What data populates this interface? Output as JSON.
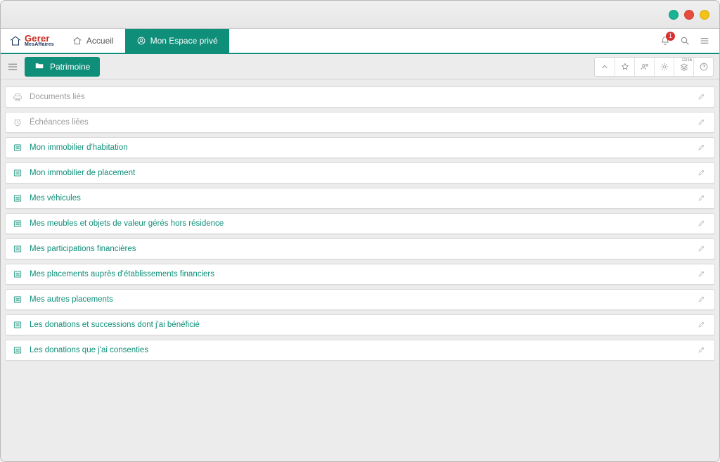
{
  "colors": {
    "accent": "#0f8f7a",
    "brand_red": "#c92a1d",
    "brand_blue": "#132d5a",
    "badge_red": "#d53131"
  },
  "brand": {
    "main": "Gerer",
    "sub": "MesAffaires"
  },
  "nav": {
    "home_label": "Accueil",
    "private_label": "Mon Espace privé"
  },
  "notifications": {
    "count": "1"
  },
  "subheader": {
    "pill_label": "Patrimoine",
    "tool_counter": "11/16"
  },
  "rows": [
    {
      "label": "Documents liés",
      "type": "muted",
      "icon": "printer"
    },
    {
      "label": "Échéances liées",
      "type": "muted",
      "icon": "clock"
    },
    {
      "label": "Mon immobilier d'habitation",
      "type": "teal",
      "icon": "list"
    },
    {
      "label": "Mon immobilier de placement",
      "type": "teal",
      "icon": "list"
    },
    {
      "label": "Mes véhicules",
      "type": "teal",
      "icon": "list"
    },
    {
      "label": "Mes meubles et objets de valeur gérés hors résidence",
      "type": "teal",
      "icon": "list"
    },
    {
      "label": "Mes participations financières",
      "type": "teal",
      "icon": "list"
    },
    {
      "label": "Mes placements auprès d'établissements financiers",
      "type": "teal",
      "icon": "list"
    },
    {
      "label": "Mes autres placements",
      "type": "teal",
      "icon": "list"
    },
    {
      "label": "Les donations et successions dont j'ai bénéficié",
      "type": "teal",
      "icon": "list"
    },
    {
      "label": "Les donations que j'ai consenties",
      "type": "teal",
      "icon": "list"
    }
  ]
}
